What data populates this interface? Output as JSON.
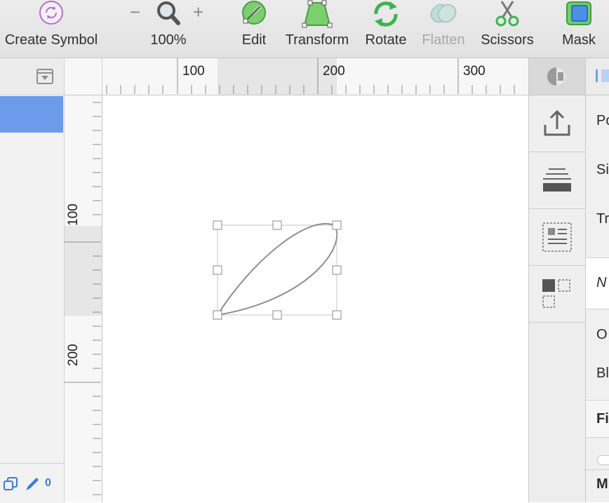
{
  "toolbar": {
    "create_symbol": "Create Symbol",
    "zoom_minus": "−",
    "zoom_plus": "+",
    "zoom_level": "100%",
    "edit": "Edit",
    "transform": "Transform",
    "rotate": "Rotate",
    "flatten": "Flatten",
    "scissors": "Scissors",
    "mask": "Mask"
  },
  "rulers": {
    "h_labels": [
      "100",
      "200",
      "300"
    ],
    "v_labels": [
      "100",
      "200"
    ]
  },
  "left_panel": {
    "footer_count": "0"
  },
  "inspector": {
    "items": [
      "Po",
      "Si",
      "Tr",
      "N",
      "O",
      "Bl",
      "Fi",
      "M"
    ]
  },
  "colors": {
    "selection_blue": "#6b9bea",
    "accent_green": "#3fb34f",
    "symbol_purple": "#b16fd0"
  }
}
